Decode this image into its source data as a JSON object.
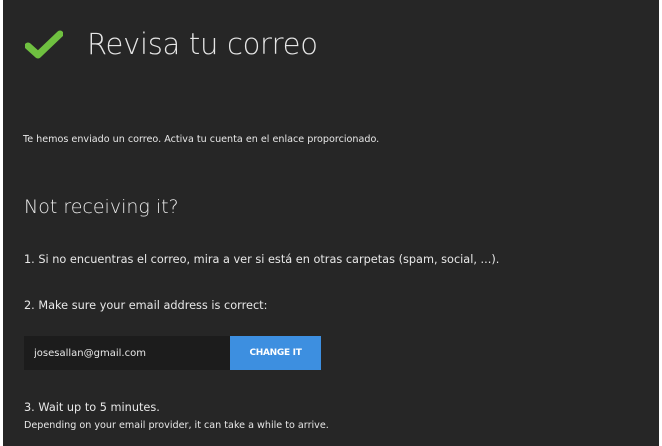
{
  "colors": {
    "background": "#262626",
    "text": "#e8e8e8",
    "check": "#6fc040",
    "button": "#3d8fe0",
    "input_background": "#1c1c1c"
  },
  "header": {
    "icon": "check-icon",
    "title": "Revisa tu correo"
  },
  "message": "Te hemos enviado un correo. Activa tu cuenta en el enlace proporcionado.",
  "help": {
    "heading": "Not receiving it?",
    "step1": "1. Si no encuentras el correo, mira a ver si está en otras carpetas (spam, social, ...).",
    "step2": "2. Make sure your email address is correct:",
    "email_value": "josesallan@gmail.com",
    "change_button": "CHANGE IT",
    "step3": "3. Wait up to 5 minutes.",
    "step3_note": "Depending on your email provider, it can take a while to arrive."
  }
}
